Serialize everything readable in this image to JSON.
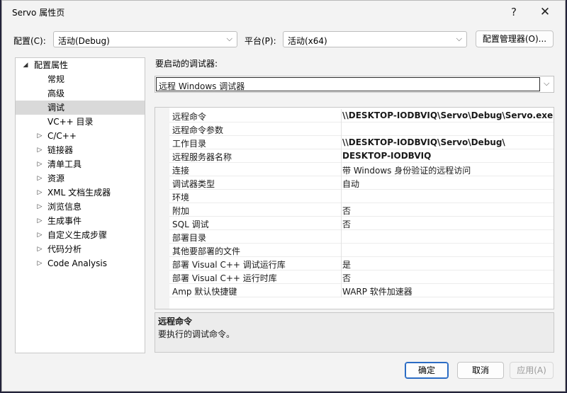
{
  "dialog": {
    "title": "Servo 属性页",
    "help_glyph": "?",
    "close_glyph": "✕"
  },
  "config_bar": {
    "config_label": "配置(C):",
    "config_value": "活动(Debug)",
    "platform_label": "平台(P):",
    "platform_value": "活动(x64)",
    "config_manager_label": "配置管理器(O)..."
  },
  "tree": {
    "items": [
      {
        "label": "配置属性",
        "expander": "◢",
        "level": 0,
        "selected": false
      },
      {
        "label": "常规",
        "expander": "",
        "level": 1,
        "selected": false
      },
      {
        "label": "高级",
        "expander": "",
        "level": 1,
        "selected": false
      },
      {
        "label": "调试",
        "expander": "",
        "level": 1,
        "selected": true
      },
      {
        "label": "VC++ 目录",
        "expander": "",
        "level": 1,
        "selected": false
      },
      {
        "label": "C/C++",
        "expander": "▷",
        "level": 1,
        "selected": false
      },
      {
        "label": "链接器",
        "expander": "▷",
        "level": 1,
        "selected": false
      },
      {
        "label": "清单工具",
        "expander": "▷",
        "level": 1,
        "selected": false
      },
      {
        "label": "资源",
        "expander": "▷",
        "level": 1,
        "selected": false
      },
      {
        "label": "XML 文档生成器",
        "expander": "▷",
        "level": 1,
        "selected": false
      },
      {
        "label": "浏览信息",
        "expander": "▷",
        "level": 1,
        "selected": false
      },
      {
        "label": "生成事件",
        "expander": "▷",
        "level": 1,
        "selected": false
      },
      {
        "label": "自定义生成步骤",
        "expander": "▷",
        "level": 1,
        "selected": false
      },
      {
        "label": "代码分析",
        "expander": "▷",
        "level": 1,
        "selected": false
      },
      {
        "label": "Code Analysis",
        "expander": "▷",
        "level": 1,
        "selected": false
      }
    ]
  },
  "debugger": {
    "label": "要启动的调试器:",
    "value": "远程 Windows 调试器"
  },
  "properties": [
    {
      "name": "远程命令",
      "value": "\\\\DESKTOP-IODBVIQ\\Servo\\Debug\\Servo.exe",
      "bold": true
    },
    {
      "name": "远程命令参数",
      "value": "",
      "bold": false
    },
    {
      "name": "工作目录",
      "value": "\\\\DESKTOP-IODBVIQ\\Servo\\Debug\\",
      "bold": true
    },
    {
      "name": "远程服务器名称",
      "value": "DESKTOP-IODBVIQ",
      "bold": true
    },
    {
      "name": "连接",
      "value": "带 Windows 身份验证的远程访问",
      "bold": false
    },
    {
      "name": "调试器类型",
      "value": "自动",
      "bold": false
    },
    {
      "name": "环境",
      "value": "",
      "bold": false
    },
    {
      "name": "附加",
      "value": "否",
      "bold": false
    },
    {
      "name": "SQL 调试",
      "value": "否",
      "bold": false
    },
    {
      "name": "部署目录",
      "value": "",
      "bold": false
    },
    {
      "name": "其他要部署的文件",
      "value": "",
      "bold": false
    },
    {
      "name": "部署 Visual C++ 调试运行库",
      "value": "是",
      "bold": false
    },
    {
      "name": "部署 Visual C++ 运行时库",
      "value": "否",
      "bold": false
    },
    {
      "name": "Amp 默认快捷键",
      "value": "WARP 软件加速器",
      "bold": false
    }
  ],
  "description": {
    "title": "远程命令",
    "text": "要执行的调试命令。"
  },
  "buttons": {
    "ok": "确定",
    "cancel": "取消",
    "apply": "应用(A)"
  },
  "icons": {
    "dropdown": "⌵"
  }
}
